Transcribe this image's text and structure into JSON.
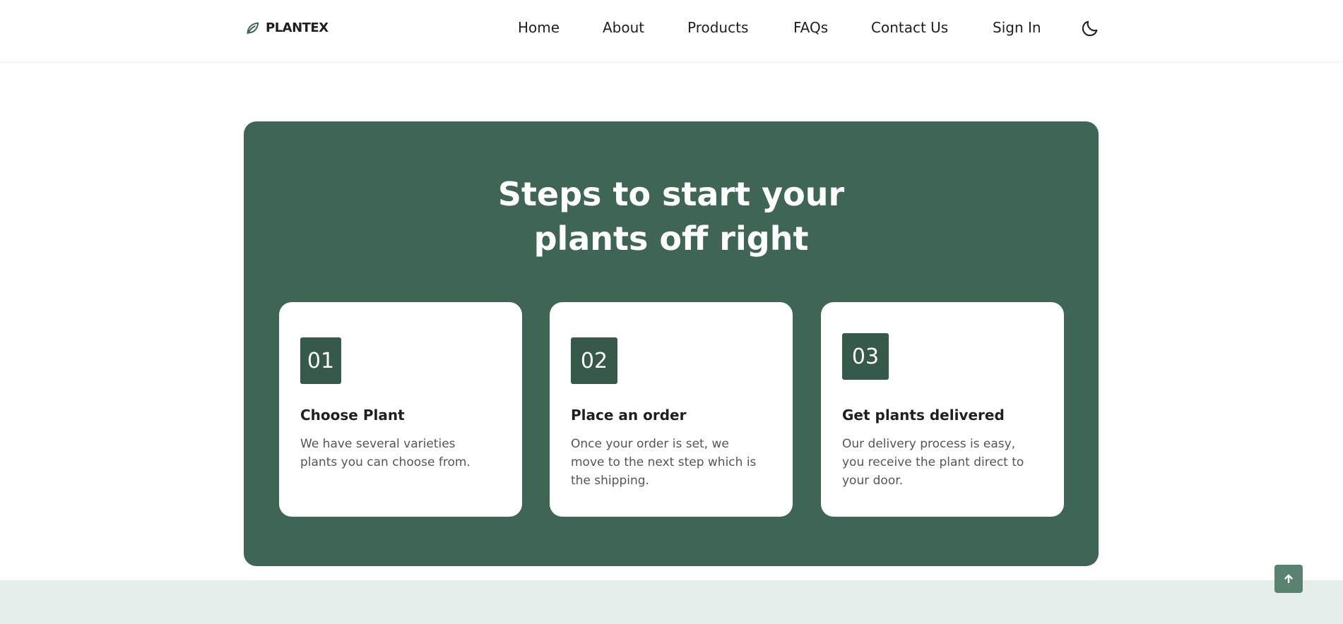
{
  "header": {
    "logo_text": "PLANTEX",
    "logo_icon": "leaf-icon",
    "nav": [
      {
        "label": "Home"
      },
      {
        "label": "About"
      },
      {
        "label": "Products"
      },
      {
        "label": "FAQs"
      },
      {
        "label": "Contact Us"
      },
      {
        "label": "Sign In"
      }
    ],
    "theme_icon": "moon-icon"
  },
  "steps": {
    "title_line1": "Steps to start your",
    "title_line2": "plants off right",
    "cards": [
      {
        "number": "01",
        "title": "Choose Plant",
        "text": "We have several varieties plants you can choose from."
      },
      {
        "number": "02",
        "title": "Place an order",
        "text": "Once your order is set, we move to the next step which is the shipping."
      },
      {
        "number": "03",
        "title": "Get plants delivered",
        "text": "Our delivery process is easy, you receive the plant direct to your door."
      }
    ]
  },
  "scroll_top": {
    "icon": "arrow-up-icon"
  },
  "colors": {
    "primary": "#3f6655",
    "number_badge": "#35594a",
    "footer_bg": "#e6eeeb",
    "scroll_button": "#5a8270"
  }
}
